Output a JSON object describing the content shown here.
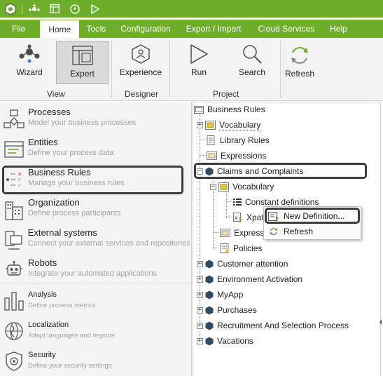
{
  "title_bar": {
    "icons": [
      "bizagi-logo-icon",
      "share-icon",
      "layout-icon",
      "compass-icon",
      "play-icon"
    ]
  },
  "menu": {
    "items": [
      "File",
      "Home",
      "Tools",
      "Configuration",
      "Export / Import",
      "Cloud Services",
      "Help"
    ],
    "active": "Home"
  },
  "ribbon": {
    "buttons": {
      "wizard": "Wizard",
      "expert": "Expert",
      "experience": "Experience",
      "run": "Run",
      "search": "Search",
      "refresh": "Refresh"
    },
    "groups": {
      "view": "View",
      "designer": "Designer",
      "project": "Project"
    },
    "selected_button": "Expert"
  },
  "left_pane": {
    "items": [
      {
        "title": "Processes",
        "desc": "Model your business processes"
      },
      {
        "title": "Entities",
        "desc": "Define your process data"
      },
      {
        "title": "Business  Rules",
        "desc": "Manage your business rules"
      },
      {
        "title": "Organization",
        "desc": "Define process participants"
      },
      {
        "title": "External systems",
        "desc": "Connect your external services and repositories"
      },
      {
        "title": "Robots",
        "desc": "Integrate your automated applications"
      },
      {
        "title": "Analysis",
        "desc": "Define process metrics"
      },
      {
        "title": "Localization",
        "desc": "Adapt languages and regions"
      },
      {
        "title": "Security",
        "desc": "Define your security settings"
      }
    ],
    "selected": "Business  Rules"
  },
  "tree": {
    "root": "Business Rules",
    "nodes": {
      "vocabulary": "Vocabulary",
      "library_rules": "Library Rules",
      "expressions": "Expressions",
      "claims": "Claims and Complaints",
      "claims_vocabulary": "Vocabulary",
      "constant_definitions": "Constant definitions",
      "xpath": "Xpat",
      "claims_expressions": "Expressi",
      "policies": "Policies",
      "customer_attention": "Customer attention",
      "environment_activation": "Environment Activation",
      "myapp": "MyApp",
      "purchases": "Purchases",
      "recruitment": "Recruitment And Selection Process",
      "vacations": "Vacations"
    }
  },
  "context_menu": {
    "items": [
      "New Definition...",
      "Refresh"
    ],
    "highlighted": "New Definition..."
  },
  "colors": {
    "brand_green": "#6fae2b",
    "ribbon_bg": "#f3f3f3",
    "callout_border": "#3d3d3d",
    "description_gray": "#a3a3a3"
  }
}
